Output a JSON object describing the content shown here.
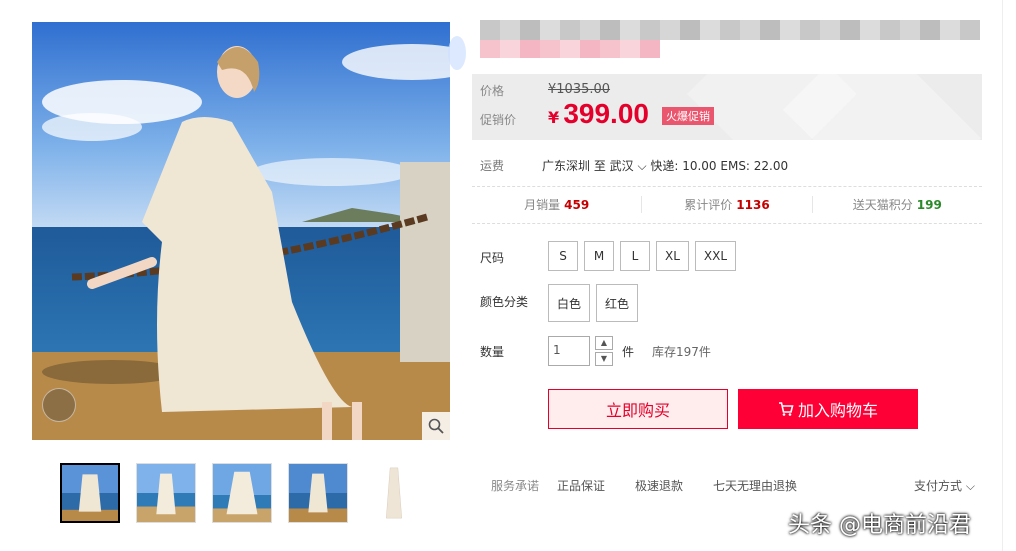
{
  "product": {
    "main_image_alt": "lace dress model seaside",
    "thumbnails": [
      "thumb-1",
      "thumb-2",
      "thumb-3",
      "thumb-4",
      "thumb-5"
    ]
  },
  "price": {
    "label_price": "价格",
    "original": "¥1035.00",
    "label_promo": "促销价",
    "currency": "¥",
    "promo": "399.00",
    "badge": "火爆促销"
  },
  "shipping": {
    "label": "运费",
    "text": "广东深圳 至 武汉 ⌵ 快递: 10.00 EMS: 22.00"
  },
  "stats": [
    {
      "label": "月销量",
      "value": "459"
    },
    {
      "label": "累计评价",
      "value": "1136"
    },
    {
      "label": "送天猫积分",
      "value": "199"
    }
  ],
  "size": {
    "label": "尺码",
    "options": [
      "S",
      "M",
      "L",
      "XL",
      "XXL"
    ]
  },
  "color": {
    "label": "颜色分类",
    "options": [
      "白色",
      "红色"
    ]
  },
  "quantity": {
    "label": "数量",
    "value": "1",
    "unit": "件",
    "stock": "库存197件"
  },
  "buttons": {
    "buy_now": "立即购买",
    "add_cart": "加入购物车"
  },
  "service": {
    "label": "服务承诺",
    "items": [
      "正品保证",
      "极速退款",
      "七天无理由退换"
    ],
    "pay": "支付方式 ⌵"
  },
  "watermark": "头条 @电商前沿君",
  "colors": {
    "accent": "#ff0036",
    "price": "#e4002b"
  }
}
